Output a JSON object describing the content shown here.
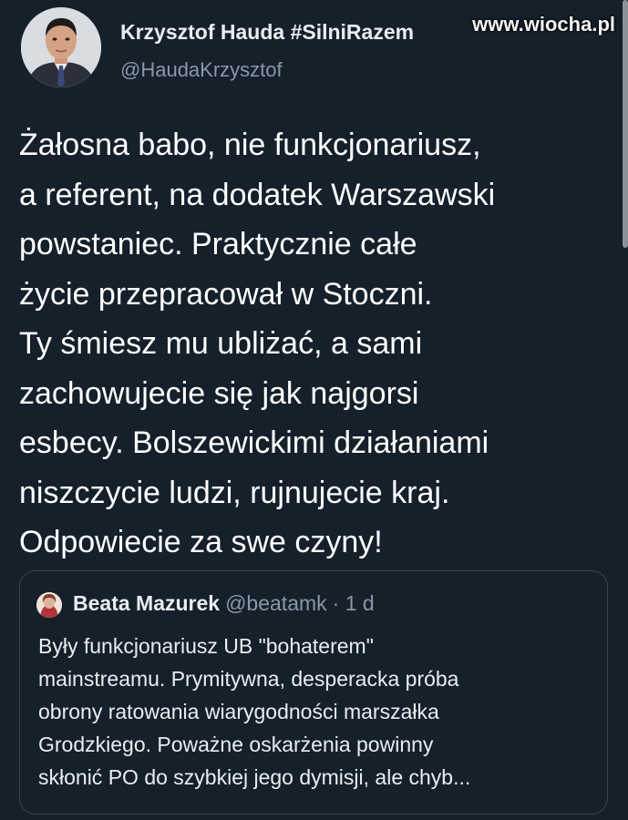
{
  "watermark": "www.wiocha.pl",
  "author": {
    "name": "Krzysztof Hauda #SilniRazem",
    "handle": "@HaudaKrzysztof"
  },
  "tweet": {
    "text": "Żałosna babo, nie funkcjonariusz,\na referent, na dodatek Warszawski\npowstaniec. Praktycznie całe\nżycie przepracował w Stoczni.\nTy śmiesz mu ubliżać, a sami\nzachowujecie się jak najgorsi\nesbecy. Bolszewickimi działaniami\nniszczycie ludzi, rujnujecie kraj.\nOdpowiecie za swe czyny!"
  },
  "quoted": {
    "name": "Beata Mazurek",
    "handle": "@beatamk",
    "time": "· 1 d",
    "text": "Były funkcjonariusz UB \"bohaterem\"\nmainstreamu. Prymitywna, desperacka próba\nobrony ratowania wiarygodności marszałka\nGrodzkiego. Poważne oskarżenia powinny\nskłonić PO do szybkiej jego dymisji, ale chyb..."
  },
  "colors": {
    "background": "#15202b",
    "text_primary": "#ffffff",
    "text_secondary": "#8899a6",
    "border": "#38444d"
  }
}
